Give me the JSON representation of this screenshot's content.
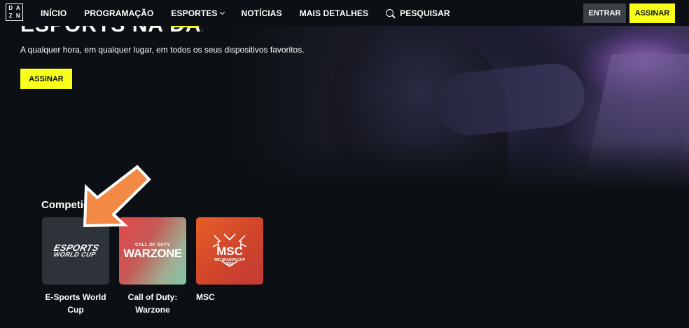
{
  "nav": {
    "logo_letters": [
      "D",
      "A",
      "Z",
      "N"
    ],
    "items": [
      {
        "label": "INÍCIO"
      },
      {
        "label": "PROGRAMAÇÃO"
      },
      {
        "label": "ESPORTES"
      },
      {
        "label": "NOTÍCIAS"
      },
      {
        "label": "MAIS DETALHES"
      }
    ],
    "search_label": "PESQUISAR",
    "login_label": "ENTRAR",
    "subscribe_label": "ASSINAR"
  },
  "hero": {
    "title": "ESPORTS NA DAZN",
    "subtitle": "A qualquer hora, em qualquer lugar, em todos os seus dispositivos favoritos.",
    "cta_label": "ASSINAR"
  },
  "competitions": {
    "title": "Competições",
    "items": [
      {
        "label": "E-Sports World Cup",
        "logo_line1": "ESPORTS",
        "logo_line2": "WORLD CUP"
      },
      {
        "label": "Call of Duty: Warzone",
        "logo_line1": "CALL OF DUTY",
        "logo_line2": "WARZONE"
      },
      {
        "label": "MSC",
        "logo_text": "MSC",
        "logo_year": "2024",
        "logo_sub": "MID SEASON CUP"
      }
    ]
  },
  "colors": {
    "accent": "#f7ff1a",
    "background": "#0c1014",
    "annotation_arrow": "#f28a45"
  }
}
